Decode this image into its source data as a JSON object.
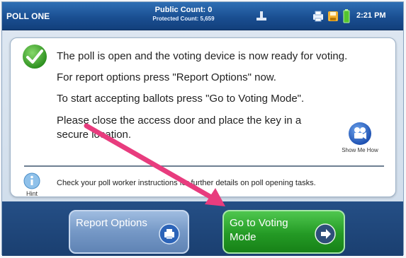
{
  "topbar": {
    "poll_name": "POLL ONE",
    "public_count": "Public Count: 0",
    "protected_count": "Protected Count: 5,659",
    "clock": "2:21 PM",
    "icons": [
      "pc-icon",
      "printer-status-icon",
      "disk-icon",
      "battery-icon"
    ]
  },
  "panel": {
    "messages": [
      "The poll is open and the voting device is now ready for voting.",
      "For report options press \"Report Options\" now.",
      "To start accepting ballots press \"Go to Voting Mode\".",
      "Please close the access door and place the key in a secure location."
    ],
    "show_me_label": "Show Me How",
    "hint_label": "Hint",
    "hint_text": "Check your poll worker instructions for further details on poll opening tasks."
  },
  "buttons": {
    "report_options": "Report Options",
    "go_to_voting": "Go to Voting Mode"
  },
  "colors": {
    "topbar": "#1a4f92",
    "report_button": "#7598c6",
    "voting_button": "#249a25",
    "annotation_arrow": "#e83c7e"
  }
}
